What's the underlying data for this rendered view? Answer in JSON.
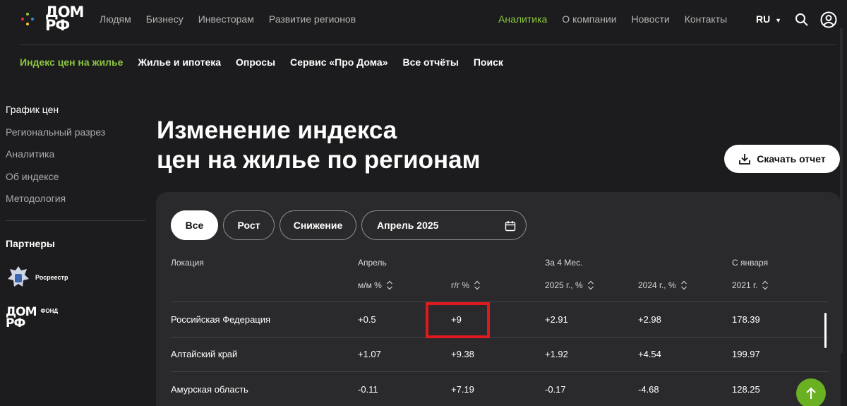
{
  "header": {
    "logo_text_line1": "ДОМ",
    "logo_text_line2": "РФ",
    "main_nav": [
      "Людям",
      "Бизнесу",
      "Инвесторам",
      "Развитие регионов"
    ],
    "right_nav": [
      {
        "label": "Аналитика",
        "active": true
      },
      {
        "label": "О компании",
        "active": false
      },
      {
        "label": "Новости",
        "active": false
      },
      {
        "label": "Контакты",
        "active": false
      }
    ],
    "language": "RU"
  },
  "subnav": [
    {
      "label": "Индекс цен на жилье",
      "active": true
    },
    {
      "label": "Жилье и ипотека",
      "active": false
    },
    {
      "label": "Опросы",
      "active": false
    },
    {
      "label": "Сервис «Про Дома»",
      "active": false
    },
    {
      "label": "Все отчёты",
      "active": false
    },
    {
      "label": "Поиск",
      "active": false
    }
  ],
  "sidebar": {
    "items": [
      {
        "label": "График цен",
        "current": true
      },
      {
        "label": "Региональный разрез",
        "current": false
      },
      {
        "label": "Аналитика",
        "current": false
      },
      {
        "label": "Об индексе",
        "current": false
      },
      {
        "label": "Методология",
        "current": false
      }
    ],
    "partners_title": "Партнеры",
    "partner1_name": "Росреестр",
    "partner2_mark_line1": "ДОМ",
    "partner2_mark_line2": "РФ",
    "partner2_name": "ФОНД"
  },
  "main": {
    "title_line1": "Изменение индекса",
    "title_line2": "цен на жилье по регионам",
    "download_label": "Скачать отчет"
  },
  "filters": {
    "chips": [
      {
        "label": "Все",
        "active": true
      },
      {
        "label": "Рост",
        "active": false
      },
      {
        "label": "Снижение",
        "active": false
      }
    ],
    "date_value": "Апрель 2025"
  },
  "table": {
    "group_headers": {
      "location": "Локация",
      "april": "Апрель",
      "four_months": "За 4 Мес.",
      "since_january": "С января"
    },
    "sub_headers": {
      "mm": "м/м %",
      "yy": "г/г %",
      "y2025": "2025 г., %",
      "y2024": "2024 г., %",
      "y2021": "2021 г."
    },
    "rows": [
      {
        "location": "Российская Федерация",
        "mm": "+0.5",
        "yy": "+9",
        "y2025": "+2.91",
        "y2024": "+2.98",
        "y2021": "178.39"
      },
      {
        "location": "Алтайский край",
        "mm": "+1.07",
        "yy": "+9.38",
        "y2025": "+1.92",
        "y2024": "+4.54",
        "y2021": "199.97"
      },
      {
        "location": "Амурская область",
        "mm": "-0.11",
        "yy": "+7.19",
        "y2025": "-0.17",
        "y2024": "-4.68",
        "y2021": "128.25"
      }
    ]
  },
  "colors": {
    "accent": "#8dc63f",
    "background": "#1c1c1e",
    "panel": "#2a2a2c",
    "highlight": "#e0191e",
    "scroll_up": "#6ab023"
  },
  "icons": [
    "dots-logo-icon",
    "search-icon",
    "user-icon",
    "download-icon",
    "calendar-icon",
    "sort-icon",
    "arrow-up-icon",
    "rosreestr-emblem-icon"
  ]
}
